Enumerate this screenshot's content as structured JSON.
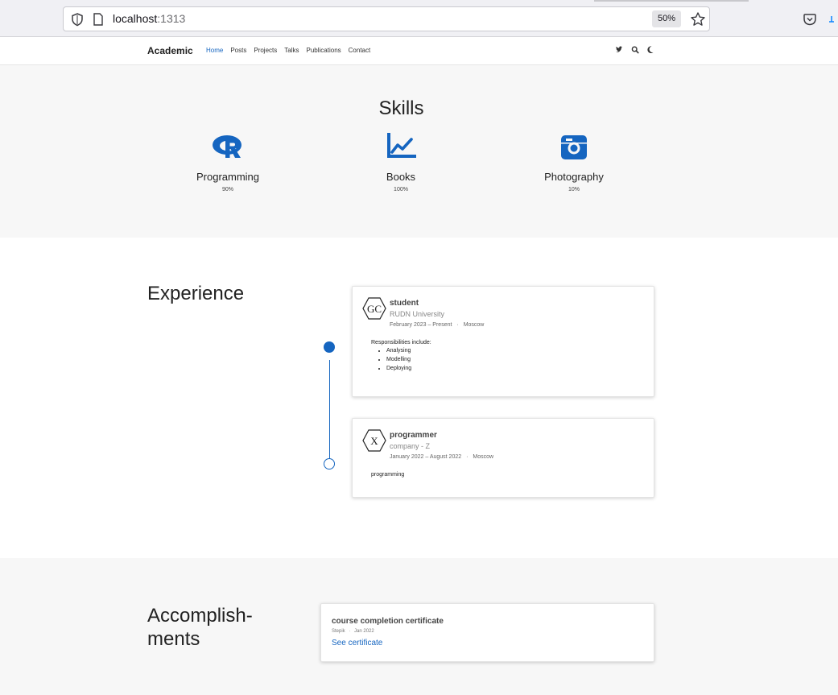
{
  "browser": {
    "url_host": "localhost",
    "url_port": ":1313",
    "zoom": "50%"
  },
  "navbar": {
    "brand": "Academic",
    "links": [
      "Home",
      "Posts",
      "Projects",
      "Talks",
      "Publications",
      "Contact"
    ],
    "active": "Home",
    "icons": [
      "twitter-icon",
      "search-icon",
      "moon-icon"
    ]
  },
  "skills": {
    "title": "Skills",
    "items": [
      {
        "name": "Programming",
        "percent": "90%",
        "icon": "r-logo-icon"
      },
      {
        "name": "Books",
        "percent": "100%",
        "icon": "chart-line-icon"
      },
      {
        "name": "Photography",
        "percent": "10%",
        "icon": "camera-icon"
      }
    ]
  },
  "experience": {
    "title": "Experience",
    "items": [
      {
        "logo_text": "GC",
        "title": "student",
        "org": "RUDN University",
        "dates": "February 2023 – Present",
        "location": "Moscow",
        "intro": "Responsibilities include:",
        "bullets": [
          "Analysing",
          "Modelling",
          "Deploying"
        ]
      },
      {
        "logo_text": "X",
        "title": "programmer",
        "org": "company - Z",
        "dates": "January 2022 – August 2022",
        "location": "Moscow",
        "intro": "programming",
        "bullets": []
      }
    ]
  },
  "accomplishments": {
    "title_line1": "Accomplish-",
    "title_line2": "ments",
    "items": [
      {
        "title": "course completion certificate",
        "org": "Stepik",
        "date": "Jan 2022",
        "link_label": "See certificate"
      }
    ]
  },
  "colors": {
    "accent": "#1565c0",
    "section_bg": "#f7f7f7"
  }
}
